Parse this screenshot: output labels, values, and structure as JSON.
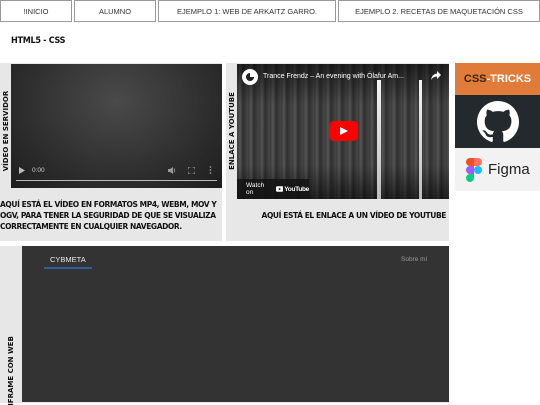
{
  "nav": {
    "items": [
      "!INICIO",
      "ALUMNO",
      "EJEMPLO 1: WEB DE ARKAITZ GARRO.",
      "EJEMPLO 2. RECETAS DE MAQUETACIÓN CSS"
    ]
  },
  "page": {
    "heading": "HTML5 - CSS"
  },
  "video_panel": {
    "side_label": "VÍDEO EN SERVIDOR",
    "time": "0:00",
    "caption": "AQUÍ ESTÁ EL VÍDEO EN FORMATOS MP4, WEBM, MOV Y OGV, PARA TENER LA SEGURIDAD DE QUE SE VISUALIZA CORRECTAMENTE EN CUALQUIER NAVEGADOR."
  },
  "youtube_panel": {
    "side_label": "ENLACE A YOUTUBE",
    "video_title": "Trance Frendz – An evening with Ólafur Am...",
    "watch_on": "Watch on",
    "brand": "YouTube",
    "caption": "AQUÍ ESTÁ EL ENLACE A UN VÍDEO DE YOUTUBE"
  },
  "sidebar": {
    "csstricks": {
      "prefix": "CSS",
      "suffix": "-TRICKS",
      "bg": "#e07b39"
    },
    "github": {
      "bg": "#24292e"
    },
    "figma": {
      "label": "Figma"
    }
  },
  "iframe_panel": {
    "side_label": "IFRAME CON WEB",
    "site_name": "CYBMETA",
    "link": "Sobre mí"
  },
  "colors": {
    "panel_bg": "#e7e7e7",
    "iframe_bg": "#333333",
    "accent_underline": "#2f5fa0",
    "yt_red": "#ff0000"
  }
}
